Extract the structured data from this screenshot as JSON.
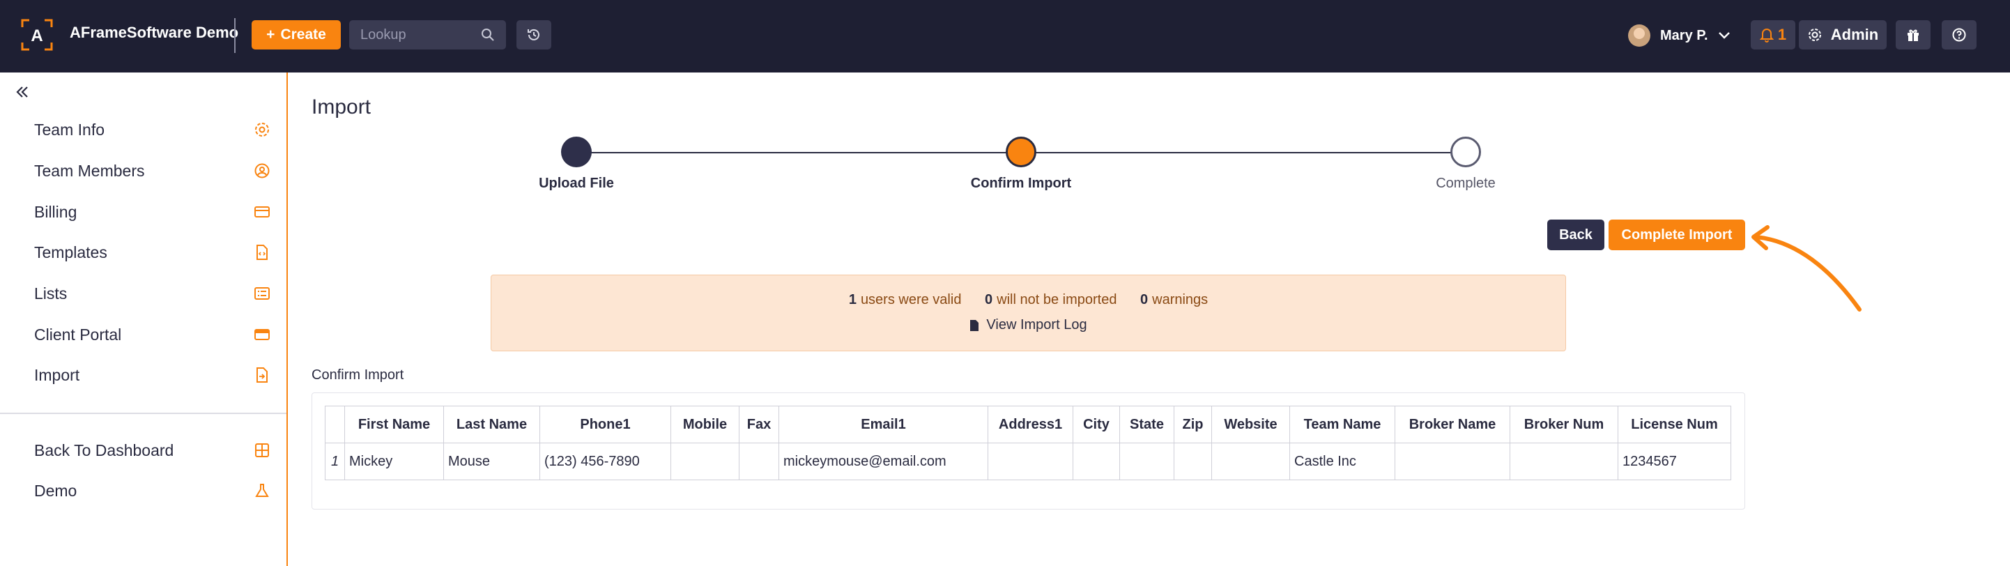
{
  "topbar": {
    "app_name": "AFrameSoftware Demo",
    "create_label": "Create",
    "lookup_placeholder": "Lookup",
    "user_name": "Mary P.",
    "notification_count": "1",
    "admin_label": "Admin",
    "bg_color": "#1e1f33",
    "accent_color": "#f98410"
  },
  "sidebar": {
    "items": [
      {
        "label": "Team Info",
        "icon": "gear-icon"
      },
      {
        "label": "Team Members",
        "icon": "user-circle-icon"
      },
      {
        "label": "Billing",
        "icon": "credit-card-icon"
      },
      {
        "label": "Templates",
        "icon": "file-code-icon"
      },
      {
        "label": "Lists",
        "icon": "list-icon"
      },
      {
        "label": "Client Portal",
        "icon": "portal-card-icon"
      },
      {
        "label": "Import",
        "icon": "file-import-icon"
      }
    ],
    "footer_items": [
      {
        "label": "Back To Dashboard",
        "icon": "grid-icon"
      },
      {
        "label": "Demo",
        "icon": "flask-icon"
      }
    ]
  },
  "main": {
    "title": "Import",
    "steps": [
      {
        "label": "Upload File",
        "state": "done"
      },
      {
        "label": "Confirm Import",
        "state": "current"
      },
      {
        "label": "Complete",
        "state": "pending"
      }
    ],
    "back_label": "Back",
    "complete_label": "Complete Import",
    "summary": {
      "valid_count": "1",
      "valid_text": "users were valid",
      "skipped_count": "0",
      "skipped_text": "will not be imported",
      "warnings_count": "0",
      "warnings_text": "warnings",
      "log_link": "View Import Log"
    },
    "section_title": "Confirm Import",
    "table": {
      "columns": [
        "",
        "First Name",
        "Last Name",
        "Phone1",
        "Mobile",
        "Fax",
        "Email1",
        "Address1",
        "City",
        "State",
        "Zip",
        "Website",
        "Team Name",
        "Broker Name",
        "Broker Num",
        "License Num"
      ],
      "rows": [
        [
          "1",
          "Mickey",
          "Mouse",
          "(123) 456-7890",
          "",
          "",
          "mickeymouse@email.com",
          "",
          "",
          "",
          "",
          "",
          "Castle Inc",
          "",
          "",
          "1234567"
        ]
      ]
    }
  }
}
